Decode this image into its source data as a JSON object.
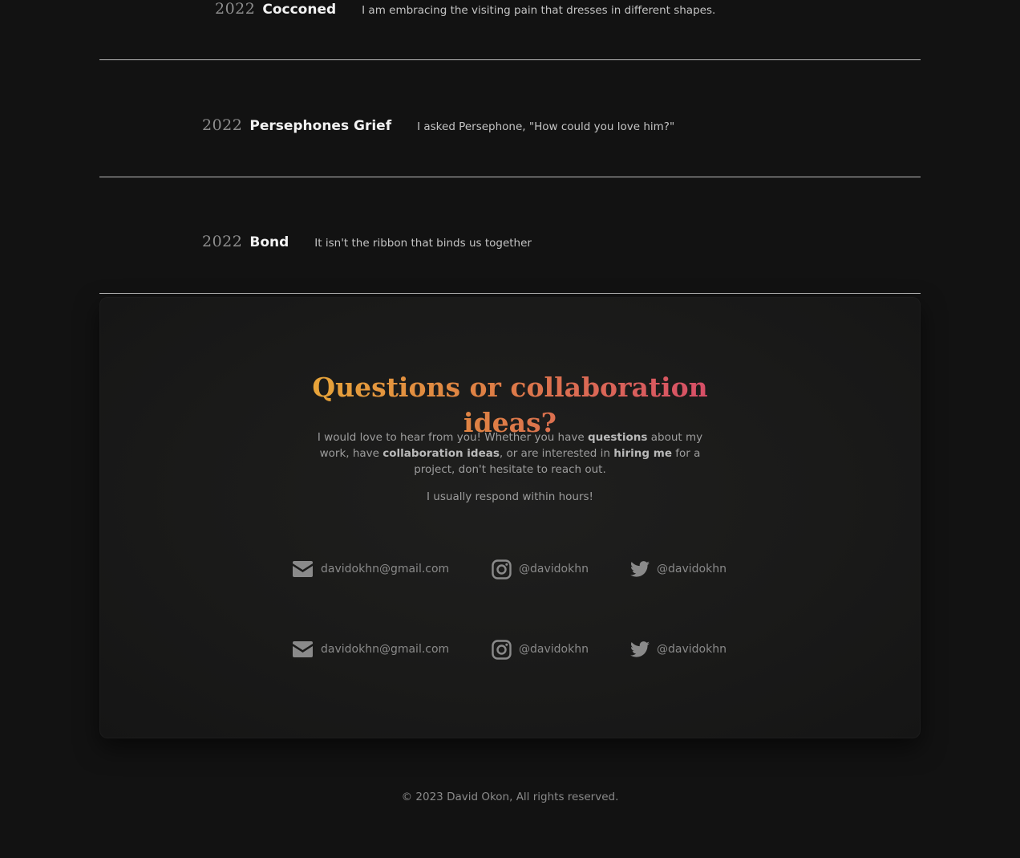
{
  "works": [
    {
      "year": "2022",
      "title": "Cocconed",
      "description": "I am embracing the visiting pain that dresses in different shapes."
    },
    {
      "year": "2022",
      "title": "Persephones Grief",
      "description": "I asked Persephone, \"How could you love him?\""
    },
    {
      "year": "2022",
      "title": "Bond",
      "description": "It isn't the ribbon that binds us together"
    }
  ],
  "contact": {
    "heading": "Questions or collaboration ideas?",
    "text": {
      "p1": "I would love to hear from you! Whether you have ",
      "b1": "questions",
      "p2": " about my work, have ",
      "b2": "collaboration ideas",
      "p3": ", or are interested in ",
      "b3": "hiring me",
      "p4": " for a project, don't hesitate to reach out."
    },
    "note": "I usually respond within hours!",
    "social_rows": [
      {
        "email": "davidokhn@gmail.com",
        "instagram": "@davidokhn",
        "twitter": "@davidokhn"
      },
      {
        "email": "davidokhn@gmail.com",
        "instagram": "@davidokhn",
        "twitter": "@davidokhn"
      }
    ],
    "icons": {
      "email": "envelope-icon",
      "instagram": "instagram-icon",
      "twitter": "twitter-bird-icon"
    },
    "colors": {
      "heading_gradient_start": "#e8a838",
      "heading_gradient_end": "#d64a6a"
    }
  },
  "footer": {
    "copyright": "© 2023 David Okon, All rights reserved."
  }
}
